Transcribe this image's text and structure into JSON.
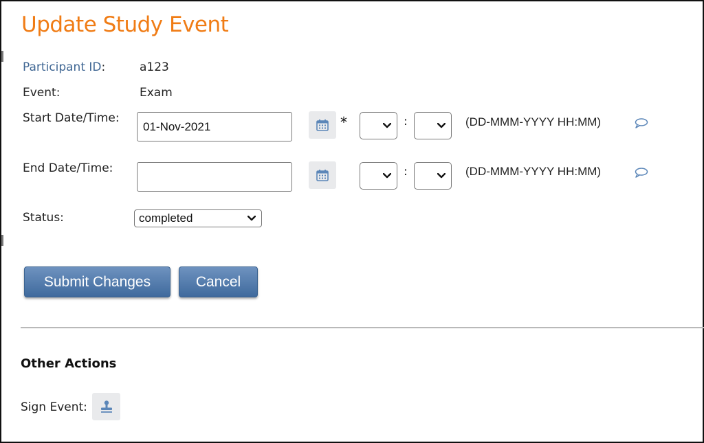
{
  "page": {
    "title": "Update Study Event"
  },
  "form": {
    "participant_id_label": "Participant ID",
    "participant_id_colon": ":",
    "participant_id_value": "a123",
    "event_label": "Event:",
    "event_value": "Exam",
    "start_label": "Start Date/Time:",
    "start_date_value": "01-Nov-2021",
    "start_required_marker": "*",
    "end_label": "End Date/Time:",
    "end_date_value": "",
    "time_separator": ":",
    "date_format_hint": "(DD-MMM-YYYY HH:MM)",
    "status_label": "Status:",
    "status_selected": "completed"
  },
  "buttons": {
    "submit_label": "Submit Changes",
    "cancel_label": "Cancel"
  },
  "other_actions": {
    "title": "Other Actions",
    "sign_event_label": "Sign Event:"
  },
  "colors": {
    "title": "#f07c15",
    "link_label": "#3f6693",
    "button_primary": "#4e78a8",
    "icon_blue": "#5b86b8"
  },
  "icons": {
    "calendar": "calendar-icon",
    "note": "speech-bubble-icon",
    "sign": "stamp-icon",
    "dropdown": "chevron-down-icon"
  }
}
